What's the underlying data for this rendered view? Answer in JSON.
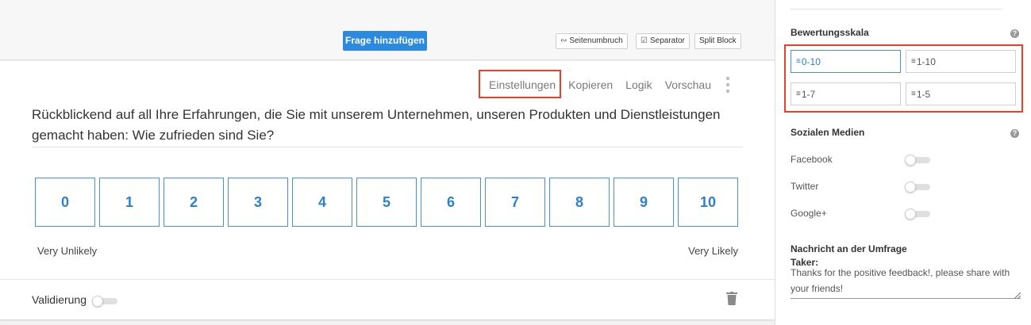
{
  "toolbar": {
    "add_question_label": "Frage hinzufügen",
    "page_break_label": "Seitenumbruch",
    "separator_label": "Separator",
    "split_block_label": "Split Block"
  },
  "question": {
    "actions": {
      "settings": "Einstellungen",
      "copy": "Kopieren",
      "logic": "Logik",
      "preview": "Vorschau"
    },
    "text": "Rückblickend auf all Ihre Erfahrungen, die Sie mit unserem Unternehmen, unseren Produkten und Dienstleistungen gemacht haben: Wie zufrieden sind Sie?",
    "scale": [
      "0",
      "1",
      "2",
      "3",
      "4",
      "5",
      "6",
      "7",
      "8",
      "9",
      "10"
    ],
    "label_low": "Very Unlikely",
    "label_high": "Very Likely",
    "validation_label": "Validierung",
    "validation_enabled": false
  },
  "panel": {
    "rating_scale_heading": "Bewertungsskala",
    "rating_options": [
      "0-10",
      "1-10",
      "1-7",
      "1-5"
    ],
    "rating_selected": "0-10",
    "social_heading": "Sozialen Medien",
    "social": [
      {
        "label": "Facebook",
        "enabled": false
      },
      {
        "label": "Twitter",
        "enabled": false
      },
      {
        "label": "Google+",
        "enabled": false
      }
    ],
    "message_heading": "Nachricht an der Umfrage Taker:",
    "message_text": "Thanks for the positive feedback!, please share with your friends!"
  },
  "colors": {
    "accent": "#2b8ae0",
    "highlight": "#e8402b"
  },
  "icons": {
    "page_break": "link-break-icon",
    "separator": "check-square-icon",
    "ruler": "ruler-icon",
    "help": "question-circle-icon",
    "trash": "trash-icon",
    "kebab": "vertical-dots-icon"
  }
}
